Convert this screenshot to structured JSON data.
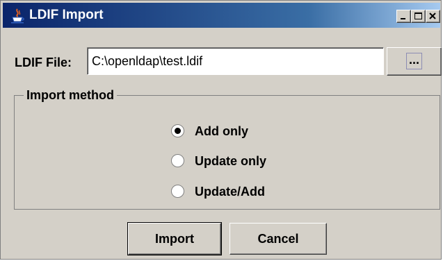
{
  "window": {
    "title": "LDIF Import",
    "icon": "java-cup-icon",
    "controls": [
      "minimize-icon",
      "maximize-icon",
      "close-icon"
    ]
  },
  "file": {
    "label": "LDIF File:",
    "value": "C:\\openldap\\test.ldif",
    "browse_label": "..."
  },
  "import_method": {
    "legend": "Import method",
    "options": [
      {
        "label": "Add only",
        "selected": true
      },
      {
        "label": "Update only",
        "selected": false
      },
      {
        "label": "Update/Add",
        "selected": false
      }
    ]
  },
  "buttons": {
    "import_label": "Import",
    "cancel_label": "Cancel"
  },
  "colors": {
    "title_gradient_start": "#0a246a",
    "title_gradient_end": "#a6caf0",
    "dialog_bg": "#d4d0c8"
  }
}
